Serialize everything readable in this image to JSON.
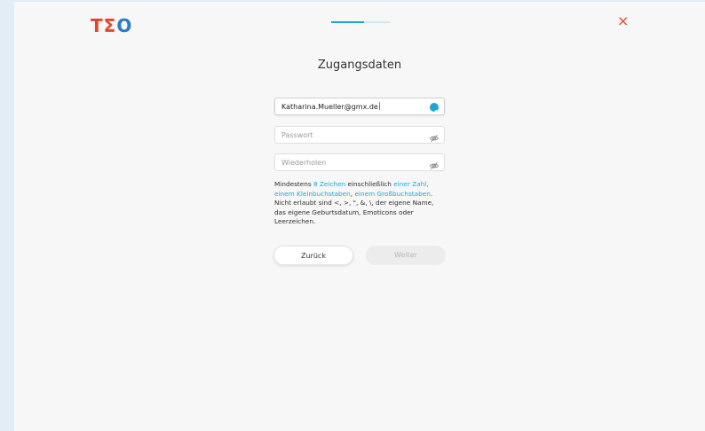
{
  "header": {
    "logo_letters": [
      "T",
      "Σ",
      "O"
    ],
    "progress": 0.55,
    "close_label": "×"
  },
  "title": "Zugangsdaten",
  "form": {
    "email": {
      "value": "Katharina.Mueller@gmx.de"
    },
    "password": {
      "placeholder": "Passwort"
    },
    "repeat": {
      "placeholder": "Wiederholen"
    }
  },
  "hint": {
    "p1": "Mindestens ",
    "h1": "8 Zeichen",
    "p2": " einschließlich ",
    "h2": "einer Zahl,",
    "h3": "einem Kleinbuchstaben",
    "p3": ", ",
    "h4": "einem Großbuchstaben",
    "p4": ".",
    "line3": "Nicht erlaubt sind <, >, \", &, \\, der eigene Name,",
    "line4": "das eigene Geburtsdatum, Emoticons oder",
    "line5": "Leerzeichen."
  },
  "buttons": {
    "back": "Zurück",
    "next": "Weiter"
  },
  "colors": {
    "accent": "#1aa7d6",
    "brand_red": "#e2452e",
    "brand_blue": "#2a7bc4"
  }
}
